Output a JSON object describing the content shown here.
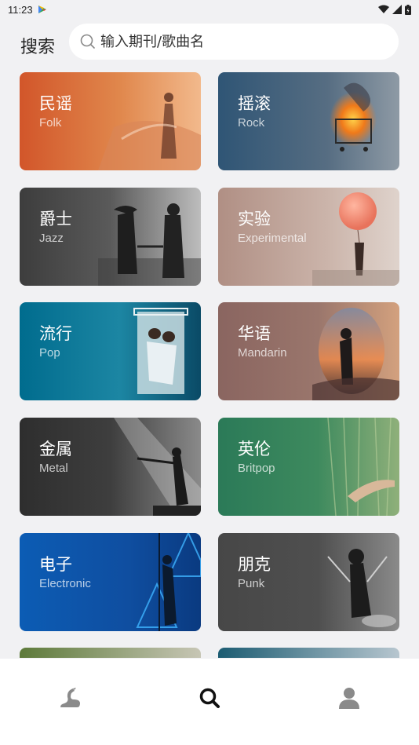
{
  "status": {
    "time": "11:23"
  },
  "search": {
    "title": "搜索",
    "placeholder": "输入期刊/歌曲名"
  },
  "genres": [
    {
      "zh": "民谣",
      "en": "Folk"
    },
    {
      "zh": "摇滚",
      "en": "Rock"
    },
    {
      "zh": "爵士",
      "en": "Jazz"
    },
    {
      "zh": "实验",
      "en": "Experimental"
    },
    {
      "zh": "流行",
      "en": "Pop"
    },
    {
      "zh": "华语",
      "en": "Mandarin"
    },
    {
      "zh": "金属",
      "en": "Metal"
    },
    {
      "zh": "英伦",
      "en": "Britpop"
    },
    {
      "zh": "电子",
      "en": "Electronic"
    },
    {
      "zh": "朋克",
      "en": "Punk"
    }
  ],
  "nav": {
    "active": "search",
    "items": [
      "home-swan-icon",
      "search-icon",
      "profile-icon"
    ]
  },
  "colors": {
    "folk": "#d9743a",
    "rock": "#3a5a7c",
    "jazz": "#4b4b4b",
    "experimental": "#b79a8c",
    "pop": "#0b6f8e",
    "mandarin": "#8f6a63",
    "metal": "#3a3a3a",
    "britpop": "#2f7a5a",
    "electronic": "#0d5fb8",
    "punk": "#4a4a4a"
  }
}
